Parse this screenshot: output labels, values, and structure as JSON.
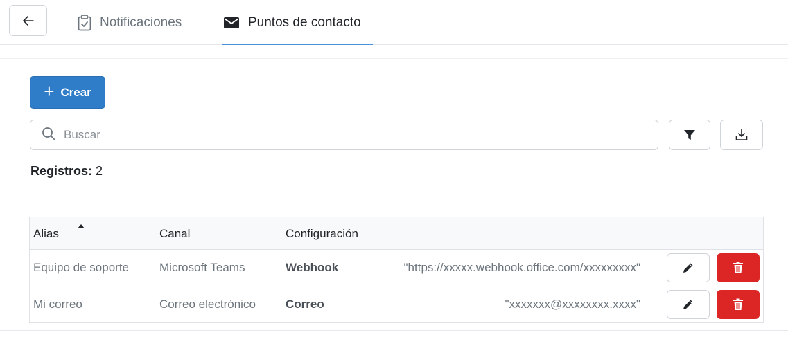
{
  "header": {
    "tabs": [
      {
        "label": "Notificaciones",
        "icon": "clipboard-check-icon",
        "active": false
      },
      {
        "label": "Puntos de contacto",
        "icon": "envelope-icon",
        "active": true
      }
    ],
    "back_icon": "arrow-left-icon"
  },
  "toolbar": {
    "create_label": "Crear",
    "search_placeholder": "Buscar",
    "filter_icon": "filter-icon",
    "download_icon": "download-icon"
  },
  "records": {
    "label": "Registros:",
    "count": "2"
  },
  "table": {
    "columns": [
      "Alias",
      "Canal",
      "Configuración"
    ],
    "sorted_column": "Alias",
    "sort_direction": "asc",
    "rows": [
      {
        "alias": "Equipo de soporte",
        "canal": "Microsoft Teams",
        "config_key": "Webhook",
        "config_value": "\"https://xxxxx.webhook.office.com/xxxxxxxxx\""
      },
      {
        "alias": "Mi correo",
        "canal": "Correo electrónico",
        "config_key": "Correo",
        "config_value": "\"xxxxxxx@xxxxxxxx.xxxx\""
      }
    ]
  },
  "colors": {
    "primary": "#2f7dc9",
    "danger": "#dc2626",
    "active_tab_underline": "#4a90d9"
  }
}
